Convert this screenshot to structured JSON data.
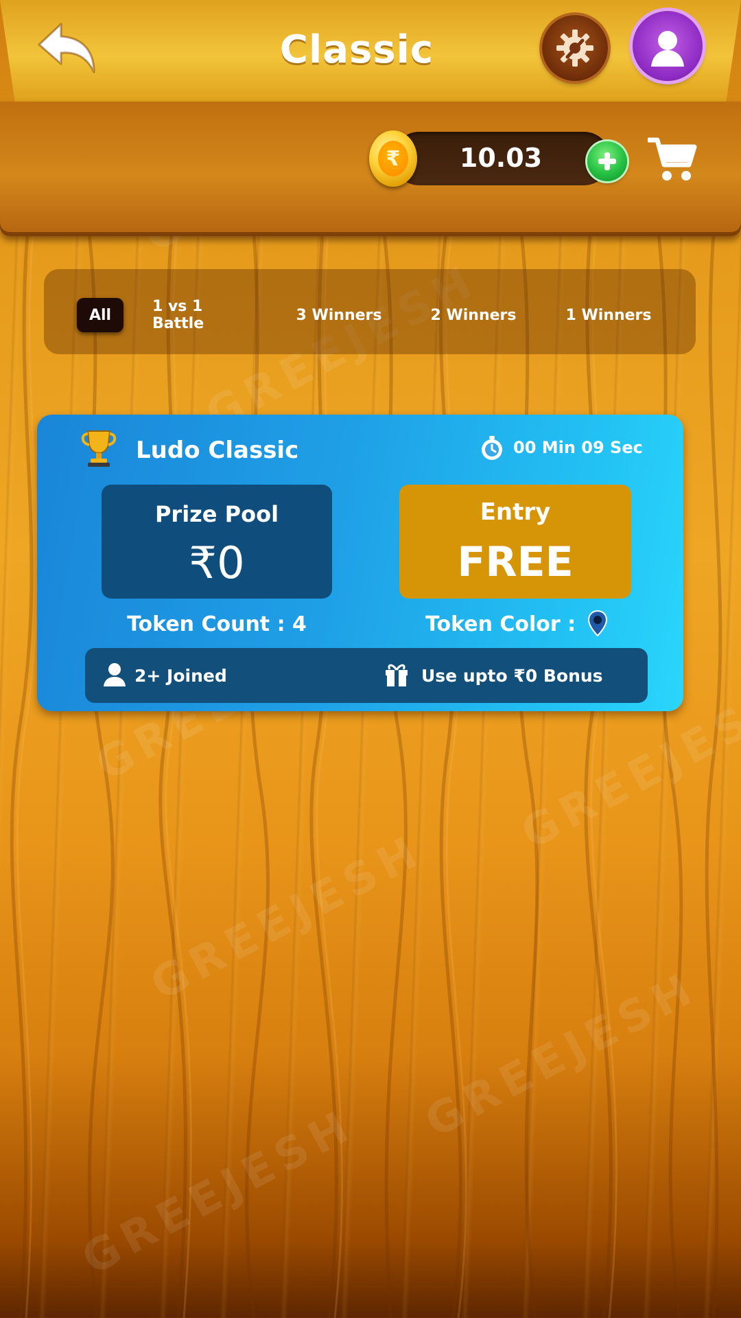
{
  "header": {
    "title": "Classic"
  },
  "wallet": {
    "balance": "10.03",
    "coin_symbol": "₹"
  },
  "filters": {
    "tabs": [
      {
        "label": "All",
        "active": true
      },
      {
        "label": "1 vs 1 Battle",
        "active": false
      },
      {
        "label": "3 Winners",
        "active": false
      },
      {
        "label": "2 Winners",
        "active": false
      },
      {
        "label": "1 Winners",
        "active": false
      }
    ]
  },
  "contest": {
    "title": "Ludo Classic",
    "timer": "00 Min 09 Sec",
    "prize_label": "Prize Pool",
    "prize_value": "₹0",
    "entry_label": "Entry",
    "entry_value": "FREE",
    "token_count": "Token Count : 4",
    "token_color_label": "Token Color :",
    "joined": "2+ Joined",
    "bonus": "Use upto ₹0 Bonus"
  },
  "watermark": "GREEJESH",
  "colors": {
    "card_gradient_start": "#1a86d8",
    "card_gradient_end": "#2ad6fb",
    "prize_box": "#0f4e7c",
    "entry_box": "#d69506",
    "header_gold": "#f2c43a",
    "add_button_green": "#25c043",
    "profile_purple": "#8e2cc4"
  },
  "icons": {
    "back": "back-arrow-icon",
    "settings": "settings-gear-icon",
    "profile": "user-avatar-icon",
    "coin": "rupee-coin-icon",
    "add": "plus-icon",
    "cart": "cart-icon",
    "trophy": "trophy-icon",
    "timer": "stopwatch-icon",
    "token_color": "map-pin-icon",
    "joined": "user-icon",
    "bonus": "gift-icon"
  }
}
